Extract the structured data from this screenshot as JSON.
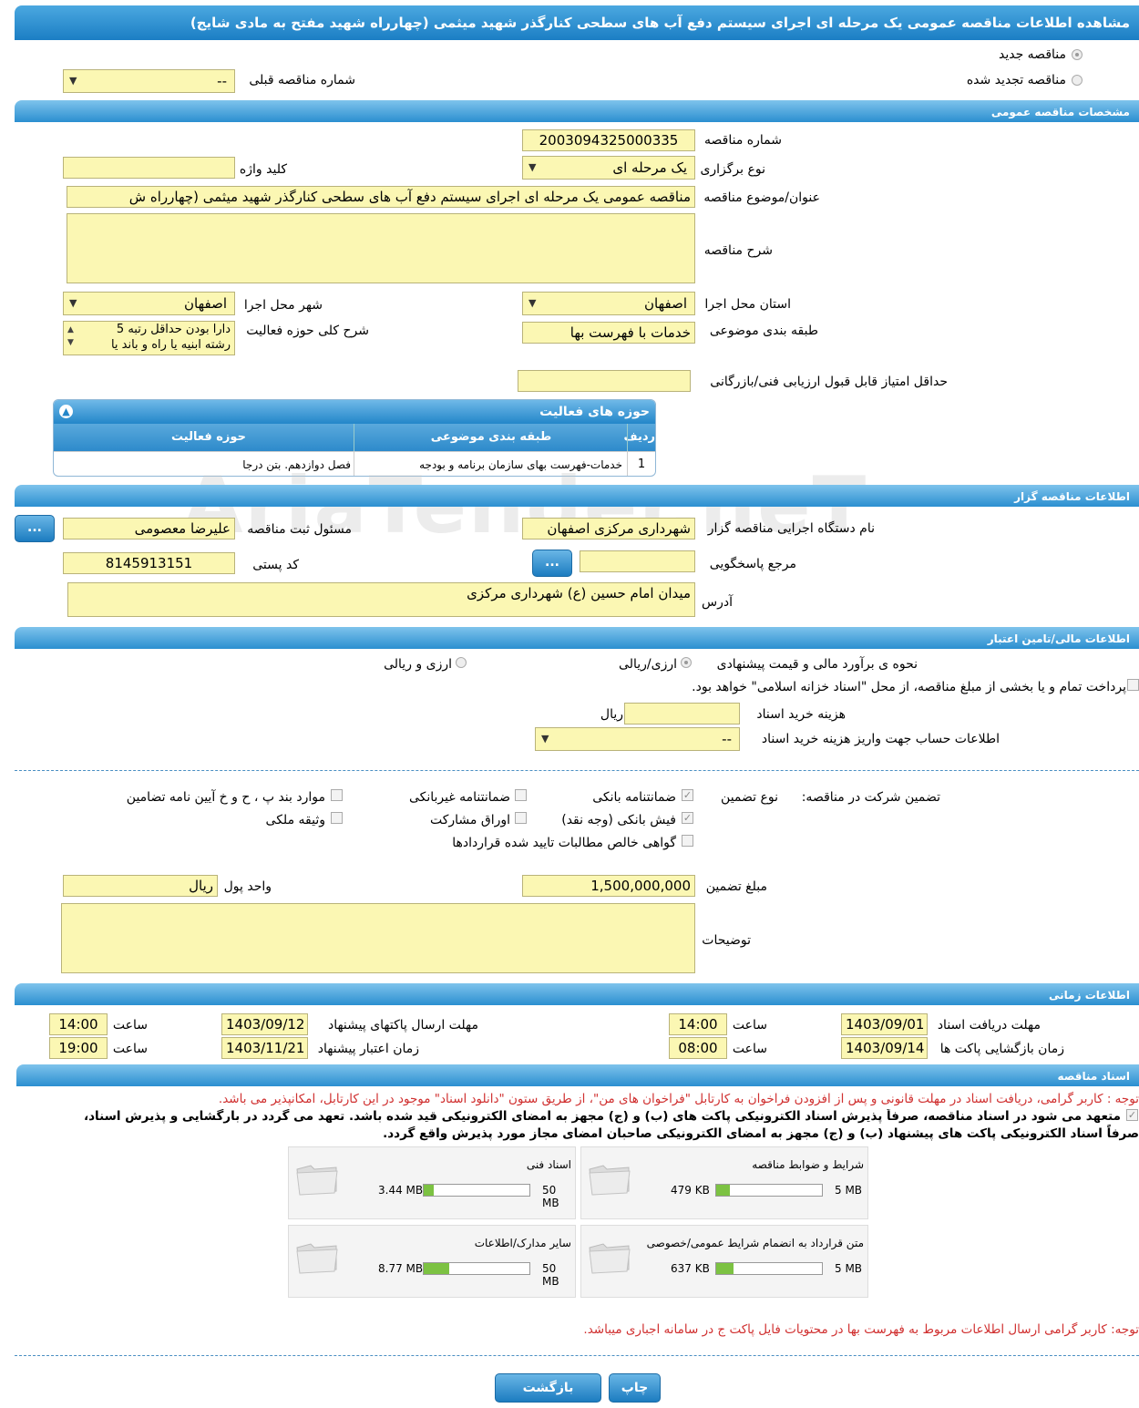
{
  "title": "مشاهده اطلاعات مناقصه عمومی یک مرحله ای اجرای سیستم دفع آب های سطحی کنارگذر شهید میثمی (چهارراه شهید مفتح به مادی شایج)",
  "top": {
    "new_tender": "مناقصه جدید",
    "renewed_tender": "مناقصه تجدید شده",
    "prev_number_label": "شماره مناقصه قبلی",
    "prev_number_value": "--"
  },
  "sections": {
    "general": "مشخصات مناقصه عمومی",
    "org": "اطلاعات مناقصه گزار",
    "finance": "اطلاعات مالی/تامین اعتبار",
    "time": "اطلاعات زمانی",
    "docs": "اسناد مناقصه"
  },
  "general": {
    "number_label": "شماره مناقصه",
    "number": "2003094325000335",
    "type_label": "نوع برگزاری",
    "type": "یک مرحله ای",
    "keyword_label": "کلید واژه",
    "keyword": "",
    "subject_label": "عنوان/موضوع مناقصه",
    "subject": "مناقصه عمومی یک مرحله ای اجرای سیستم دفع آب های سطحی کنارگذر شهید میثمی (چهارراه ش",
    "desc_label": "شرح مناقصه",
    "desc": "",
    "province_label": "استان محل اجرا",
    "province": "اصفهان",
    "city_label": "شهر محل اجرا",
    "city": "اصفهان",
    "category_label": "طبقه بندی موضوعی",
    "category": "خدمات با فهرست بها",
    "activity_desc_label": "شرح کلی حوزه فعالیت",
    "activity_desc_line1": "دارا بودن حداقل رتبه 5",
    "activity_desc_line2": "رشته ابنیه یا راه و باند یا",
    "min_score_label": "حداقل امتیاز قابل قبول ارزیابی فنی/بازرگانی",
    "min_score": ""
  },
  "activities": {
    "title": "حوزه های فعالیت",
    "headers": [
      "ردیف",
      "طبقه بندی موضوعی",
      "حوزه فعالیت"
    ],
    "rows": [
      {
        "idx": "1",
        "category": "خدمات-فهرست بهای سازمان برنامه و بودجه",
        "field": "فصل دوازدهم. بتن درجا"
      }
    ]
  },
  "org": {
    "agency_label": "نام دستگاه اجرایی مناقصه گزار",
    "agency": "شهرداری مرکزی اصفهان",
    "registrar_label": "مسئول ثبت مناقصه",
    "registrar": "علیرضا معصومی",
    "ref_label": "مرجع پاسخگویی",
    "ref": "",
    "postal_label": "کد پستی",
    "postal": "8145913151",
    "address_label": "آدرس",
    "address": "میدان امام حسین (ع) شهرداری مرکزی",
    "more_btn": "..."
  },
  "finance": {
    "method_label": "نحوه ی برآورد مالی و قیمت پیشنهادی",
    "opt1": "ارزی/ریالی",
    "opt2": "ارزی و ریالی",
    "treasury_text": "پرداخت تمام و یا بخشی از مبلغ مناقصه، از محل \"اسناد خزانه اسلامی\" خواهد بود.",
    "doc_cost_label": "هزینه خرید اسناد",
    "doc_cost": "",
    "doc_cost_unit": "ریال",
    "account_label": "اطلاعات حساب جهت واریز هزینه خرید اسناد",
    "account": "--"
  },
  "guarantee": {
    "label": "تضمین شرکت در مناقصه:",
    "type_label": "نوع تضمین",
    "bank_guarantee": "ضمانتنامه بانکی",
    "nonbank_guarantee": "ضمانتنامه غیربانکی",
    "other_items": "موارد بند پ ، ح و خ آیین نامه تضامین",
    "bank_receipt": "فیش بانکی (وجه نقد)",
    "bonds": "اوراق مشارکت",
    "property": "وثیقه ملکی",
    "claims": "گواهی خالص مطالبات تایید شده قراردادها",
    "amount_label": "مبلغ تضمین",
    "amount": "1,500,000,000",
    "currency_label": "واحد پول",
    "currency": "ریال",
    "notes_label": "توضیحات",
    "notes": ""
  },
  "time": {
    "receive_label": "مهلت دریافت اسناد",
    "receive_date": "1403/09/01",
    "receive_time": "14:00",
    "send_label": "مهلت ارسال پاکتهای پیشنهاد",
    "send_date": "1403/09/12",
    "send_time": "14:00",
    "open_label": "زمان بازگشایی پاکت ها",
    "open_date": "1403/09/14",
    "open_time": "08:00",
    "valid_label": "زمان اعتبار پیشنهاد",
    "valid_date": "1403/11/21",
    "valid_time": "19:00",
    "hour_label": "ساعت"
  },
  "docs": {
    "note1": "توجه : کاربر گرامی، دریافت اسناد در مهلت قانونی و پس از افزودن فراخوان به کارتابل \"فراخوان های من\"، از طریق ستون \"دانلود اسناد\" موجود در این کارتابل، امکانپذیر می باشد.",
    "commit1": "متعهد می شود در اسناد مناقصه، صرفاً پذیرش اسناد الکترونیکی پاکت های (ب) و (ج) مجهز به امضای الکترونیکی قید شده باشد. تعهد می گردد در بارگشایی و پذیرش اسناد،",
    "commit2": "صرفاً اسناد الکترونیکی پاکت های پیشنهاد (ب) و (ج) مجهز به امضای الکترونیکی صاحبان امضای مجاز مورد پذیرش واقع گردد.",
    "files": [
      {
        "name": "شرایط و ضوابط مناقصه",
        "used": "479 KB",
        "max": "5 MB",
        "fill": 0.09
      },
      {
        "name": "اسناد فنی",
        "used": "3.44 MB",
        "max": "50 MB",
        "fill": 0.07
      },
      {
        "name": "متن قرارداد به انضمام شرایط عمومی/خصوصی",
        "used": "637 KB",
        "max": "5 MB",
        "fill": 0.12
      },
      {
        "name": "سایر مدارک/اطلاعات",
        "used": "8.77 MB",
        "max": "50 MB",
        "fill": 0.17
      }
    ],
    "note2": "توجه: کاربر گرامی ارسال اطلاعات مربوط به فهرست بها در محتویات فایل پاکت ج در سامانه اجباری میباشد."
  },
  "buttons": {
    "print": "چاپ",
    "back": "بازگشت"
  },
  "watermark": "AriaTender.neT",
  "colors": {
    "header_blue": "#2b8fd0",
    "field_yellow": "#fbf7b3",
    "note_red": "#d03030",
    "progress_green": "#7cc242"
  }
}
